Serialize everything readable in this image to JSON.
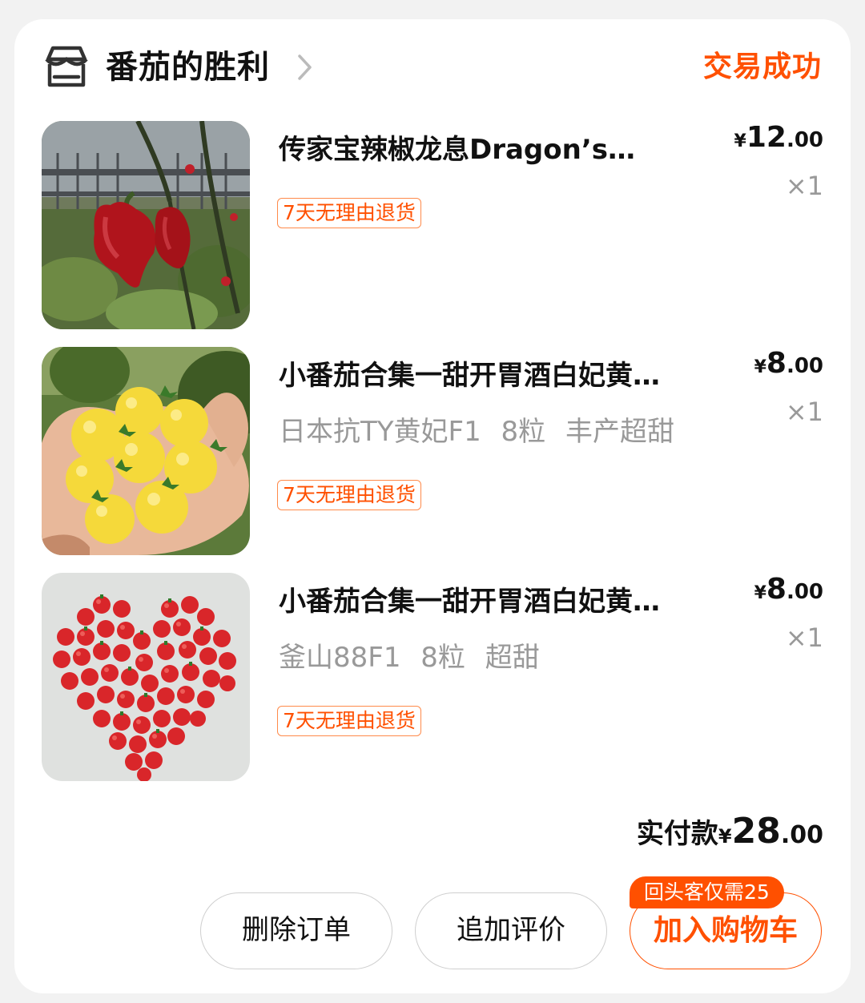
{
  "shop": {
    "name": "番茄的胜利",
    "status": "交易成功",
    "icon": "store-icon"
  },
  "items": [
    {
      "title": "传家宝辣椒龙息Dragon’s…",
      "sku": "",
      "badge": "7天无理由退货",
      "price_currency": "¥",
      "price_int": "12",
      "price_dec": ".00",
      "qty": "×1",
      "image": "red-chili-peppers-photo"
    },
    {
      "title": "小番茄合集一甜开胃酒白妃黄…",
      "sku": "日本抗TY黄妃F1  8粒  丰产超甜",
      "badge": "7天无理由退货",
      "price_currency": "¥",
      "price_int": "8",
      "price_dec": ".00",
      "qty": "×1",
      "image": "yellow-cherry-tomatoes-photo"
    },
    {
      "title": "小番茄合集一甜开胃酒白妃黄…",
      "sku": "釜山88F1  8粒   超甜",
      "badge": "7天无理由退货",
      "price_currency": "¥",
      "price_int": "8",
      "price_dec": ".00",
      "qty": "×1",
      "image": "red-tomato-heart-photo"
    }
  ],
  "total": {
    "label": "实付款",
    "currency": "¥",
    "int": "28",
    "dec": ".00"
  },
  "actions": {
    "delete_label": "删除订单",
    "review_label": "追加评价",
    "cart_label": "加入购物车",
    "promo_label": "回头客仅需25"
  },
  "colors": {
    "accent": "#ff5000",
    "text": "#111111",
    "muted": "#999999",
    "background": "#f2f2f2",
    "card": "#ffffff"
  }
}
